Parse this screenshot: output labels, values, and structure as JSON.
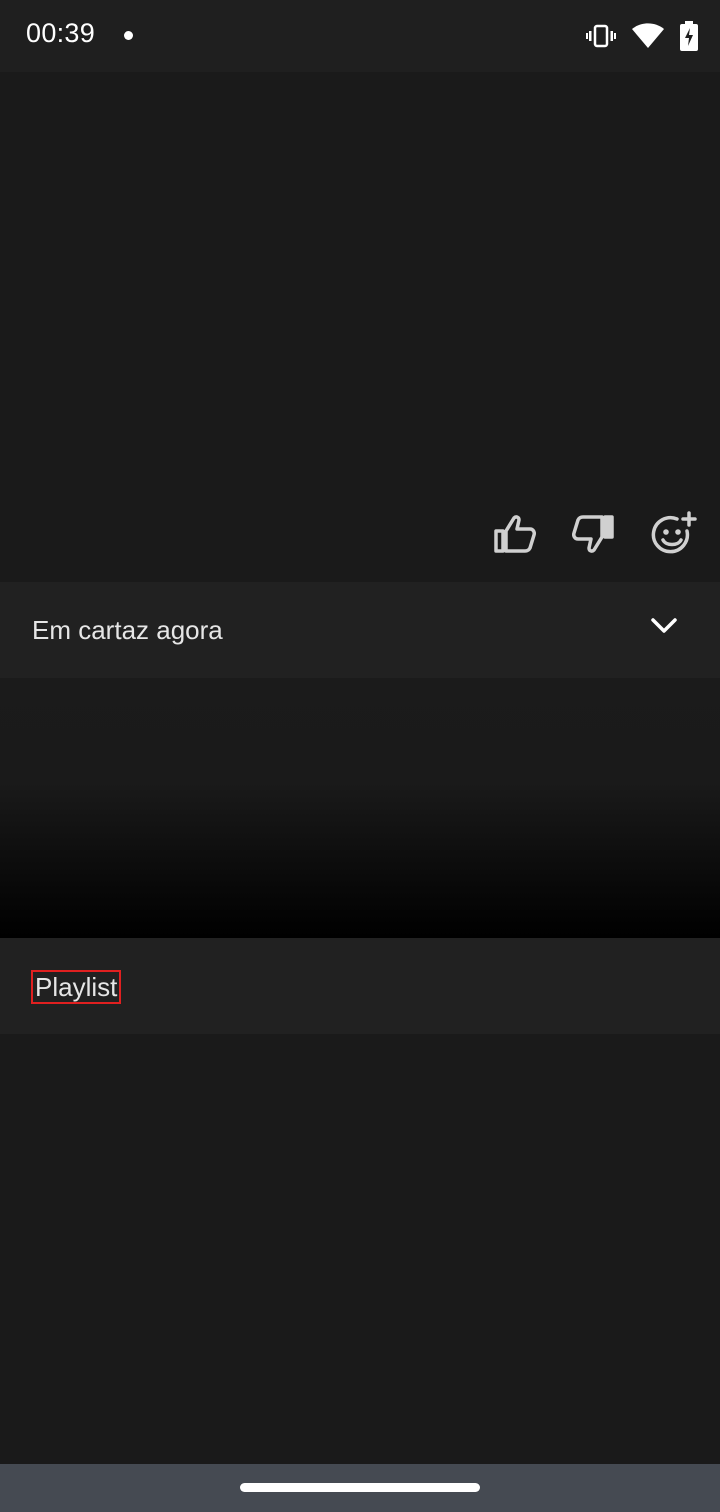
{
  "status_bar": {
    "time": "00:39",
    "icons": [
      "notification-dot-icon",
      "vibrate-icon",
      "wifi-icon",
      "battery-charging-icon"
    ]
  },
  "player": {
    "reactions": [
      "thumbs-up-icon",
      "thumbs-down-icon",
      "add-reaction-icon"
    ]
  },
  "now_playing": {
    "label": "Em cartaz agora",
    "toggle_icon": "chevron-down-icon"
  },
  "playlist": {
    "label": "Playlist"
  },
  "colors": {
    "background": "#1a1a1a",
    "row_background": "#212121",
    "nav_bar": "#454a52",
    "text": "#e6e6e6",
    "highlight_outline": "#e02020"
  }
}
